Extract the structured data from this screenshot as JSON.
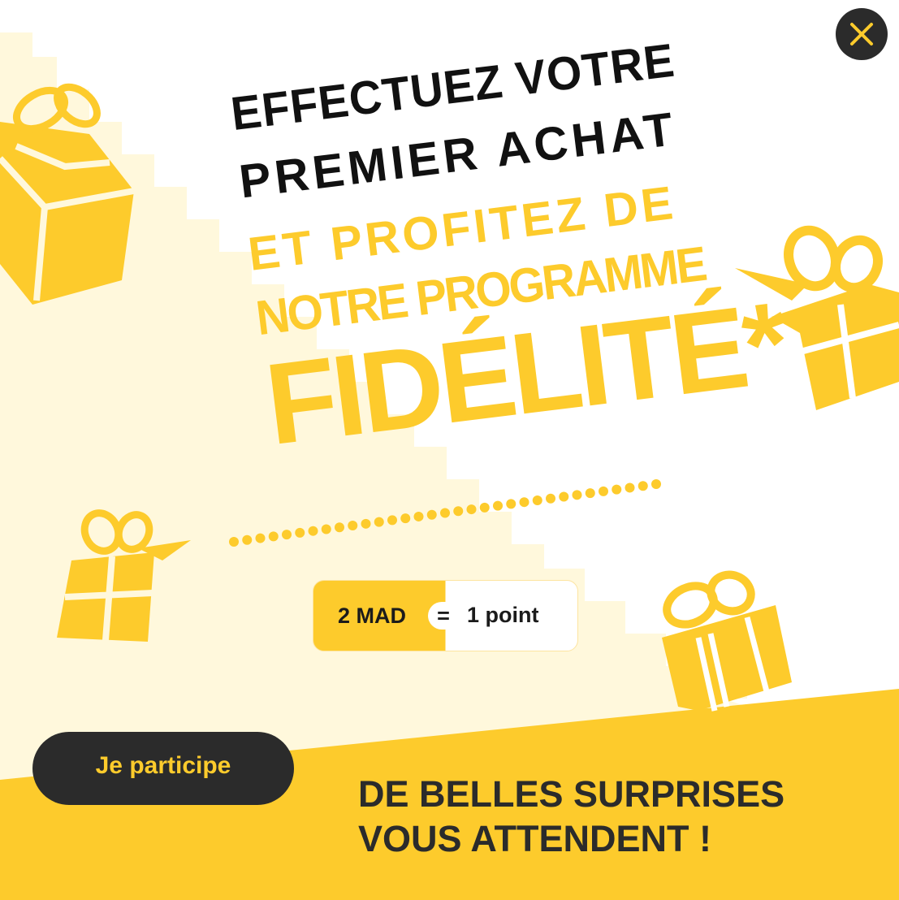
{
  "close": {
    "label": "×"
  },
  "headline": {
    "line1": "EFFECTUEZ VOTRE",
    "line2": "PREMIER ACHAT",
    "line3": "ET PROFITEZ DE",
    "line4": "NOTRE PROGRAMME",
    "line5": "FIDÉLITÉ*"
  },
  "points": {
    "amount": "2 MAD",
    "equals": "=",
    "reward": "1 point"
  },
  "cta": {
    "label": "Je participe"
  },
  "footer": {
    "line1": "DE BELLES SURPRISES",
    "line2": "VOUS ATTENDENT !"
  },
  "colors": {
    "brand_yellow": "#fdcb2c",
    "dark": "#2b2b2b",
    "cream": "#fff8dc"
  },
  "icons": [
    "close-icon",
    "gift-icon"
  ]
}
